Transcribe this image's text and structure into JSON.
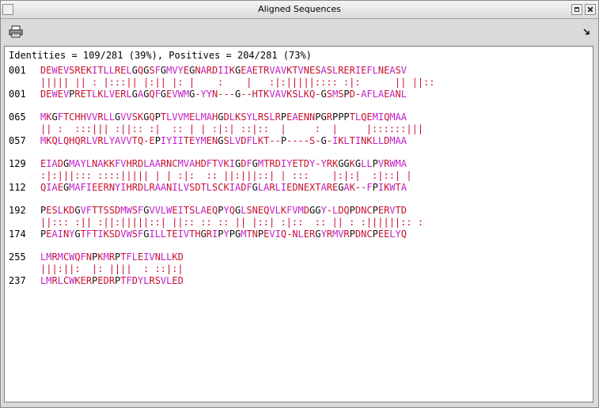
{
  "window": {
    "title": "Aligned Sequences"
  },
  "toolbar": {
    "print_icon": "printer-icon",
    "corner_icon": "resize-arrow-icon"
  },
  "summary": "Identities = 109/281 (39%), Positives = 204/281 (73%)",
  "blocks": [
    {
      "q_start": "001",
      "query": "DEWEVSREKITLLRELGQGSFGMVYEGNARDIIKGEAETRVAVKTVNESASLRERIEFLNEASV",
      "match": "||||| || : |:::|| |:|| |: |    :    |   :|:|||||:::: :|:      || ||::",
      "s_start": "001",
      "subject": "DEWEVPRETLKLVERLGAGQFGEVWMG-YYN---G--HTKVAVKSLKQ-GSMSPD-AFLAEANL"
    },
    {
      "q_start": "065",
      "query": "MKGFTCHHVVRLLGVVSKGQPTLVVMELMAHGDLKSYLRSLRPEAENNPGRPPPTLQEMIQMAA",
      "match": "|| :  :::||| :||:: :|  :: | | :|:| ::|::  |     :  |     |::::::|||",
      "s_start": "057",
      "subject": "MKQLQHQRLVRLYAVVTQ-EPIYIITEYMENGSLVDFLKT--P----S-G-IKLTINKLLDMAA"
    },
    {
      "q_start": "129",
      "query": "EIADGMAYLNAKKFVHRDLAARNCMVAHDFTVKIGDFGMTRDIYETDY-YRKGGKGLLPVRWMA",
      "match": ":|:|||::: ::::||||| | | :|:  :: ||:|||::| | :::    |:|:|  :|::| |",
      "s_start": "112",
      "subject": "QIAEGMAFIEERNYIHRDLRAANILVSDTLSCKIADFGLARLIEDNEXTAREGAK--FPIKWTA"
    },
    {
      "q_start": "192",
      "query": "PESLKDGVFTTSSDMWSFGVVLWEITSLAEQPYQGLSNEQVLKFVMDGGY-LDQPDNCPERVTD",
      "match": "||::: :|| :||:|||||::| ||:: :: :: || |::| :|::  :: || : :||||||:: :",
      "s_start": "174",
      "subject": "PEAINYGTFTIKSDVWSFGILLTEIVTHGRIPYPGMTNPEVIQ-NLERGYRMVRPDNCPEELYQ"
    },
    {
      "q_start": "255",
      "query": "LMRMCWQFNPKMRPTFLEIVNLLKD",
      "match": "|||:||:  |: ||||  : ::|:|",
      "s_start": "237",
      "subject": "LMRLCWKERPEDRPTFDYLRSVLED"
    }
  ]
}
